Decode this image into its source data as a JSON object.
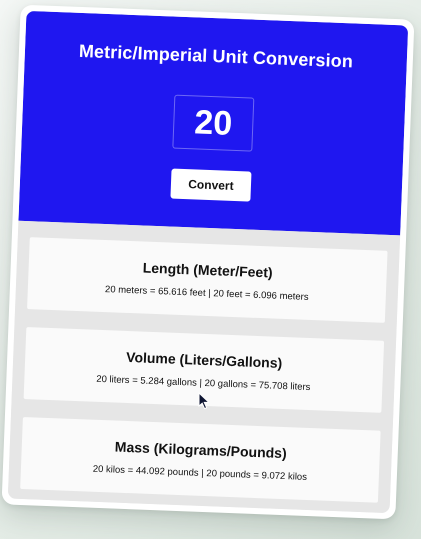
{
  "header": {
    "title": "Metric/Imperial Unit Conversion",
    "value": "20",
    "convert_label": "Convert"
  },
  "results": [
    {
      "title": "Length (Meter/Feet)",
      "text": "20 meters = 65.616 feet | 20 feet = 6.096 meters"
    },
    {
      "title": "Volume (Liters/Gallons)",
      "text": "20 liters = 5.284 gallons | 20 gallons = 75.708 liters"
    },
    {
      "title": "Mass (Kilograms/Pounds)",
      "text": "20 kilos = 44.092 pounds | 20 pounds = 9.072 kilos"
    }
  ],
  "colors": {
    "header_bg": "#1f17f0",
    "results_bg": "#e6e6e6",
    "card_bg": "#fafafa"
  },
  "icons": {
    "cursor": "mouse-pointer-icon"
  }
}
